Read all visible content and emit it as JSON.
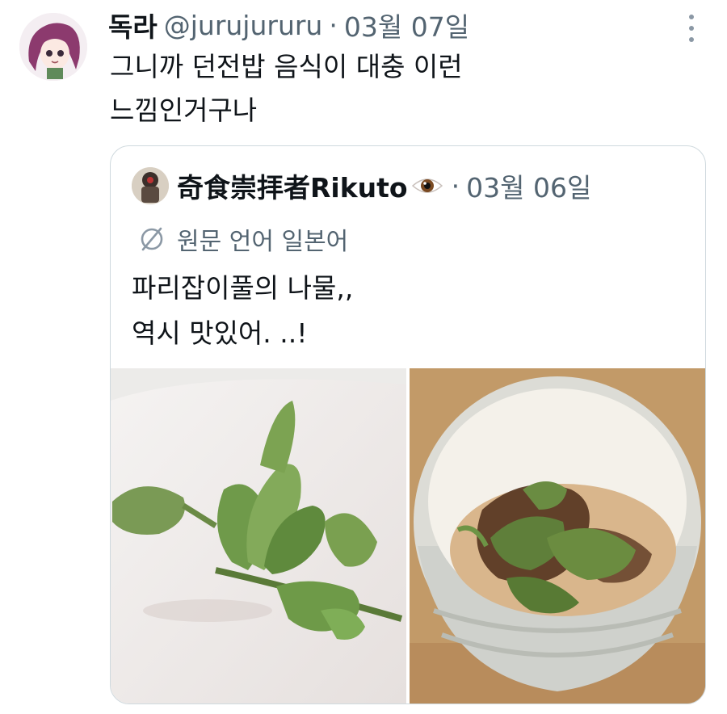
{
  "tweet": {
    "author_name": "독라",
    "handle": "@jurujururu",
    "separator": "·",
    "date": "03월 07일",
    "text_lines": [
      "그니까 던전밥 음식이 대충 이런",
      "느낌인거구나"
    ],
    "more_icon": "more-vertical-icon"
  },
  "quote": {
    "author_name": "奇食崇拝者Rikuto",
    "eye_emoji": "eye-icon",
    "separator": "·",
    "date": "03월 06일",
    "translate_label": "원문 언어 일본어",
    "translate_icon": "translate-icon",
    "text_lines": [
      "파리잡이풀의 나물,,",
      "역시 맛있어. ..!"
    ],
    "images": [
      "venus-flytrap-fresh-photo",
      "venus-flytrap-in-bowl-photo"
    ]
  },
  "colors": {
    "text_primary": "#0f1419",
    "text_secondary": "#536471",
    "border": "#cfd9de"
  }
}
